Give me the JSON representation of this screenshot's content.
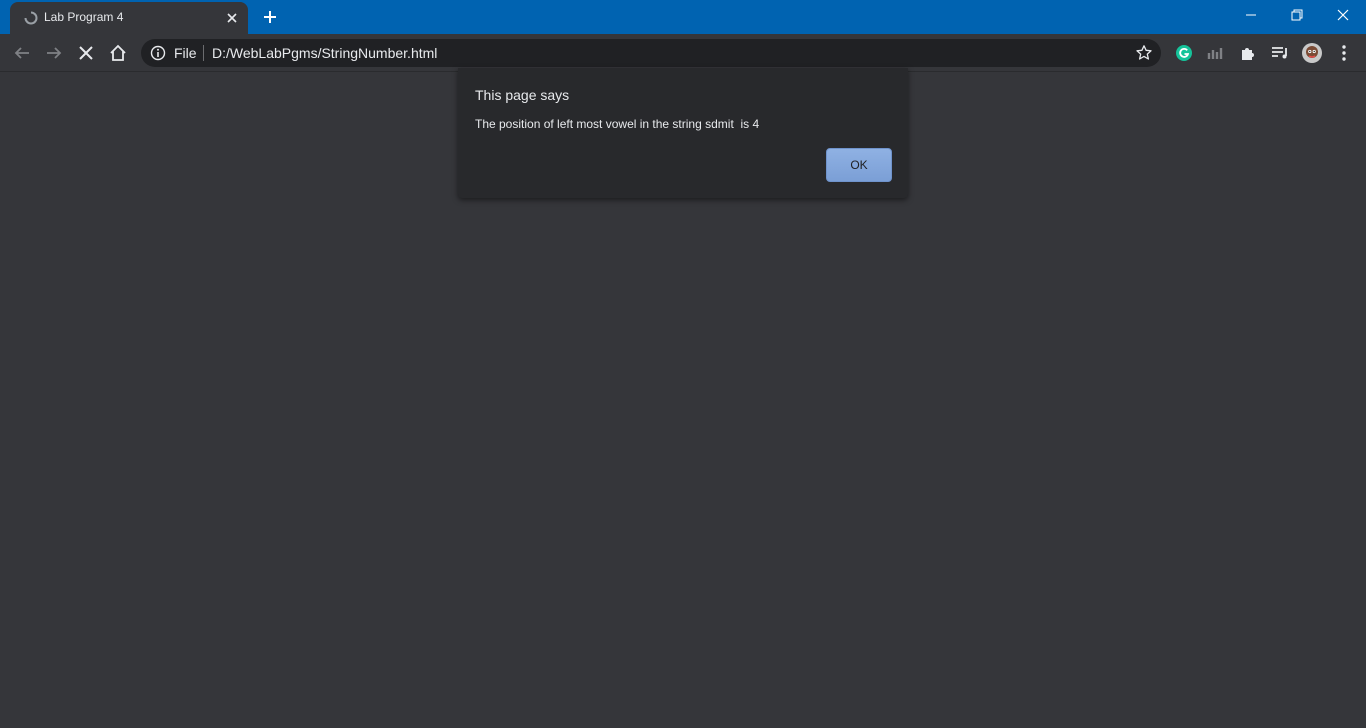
{
  "tab": {
    "title": "Lab Program 4"
  },
  "omnibox": {
    "scheme": "File",
    "url": "D:/WebLabPgms/StringNumber.html"
  },
  "dialog": {
    "heading": "This page says",
    "message": "The position of left most vowel in the string sdmit  is 4",
    "ok_label": "OK"
  },
  "colors": {
    "titlebar": "#0063b1",
    "page_background": "#35363a",
    "dialog_background": "#28292c",
    "ok_button": "#8ab4f8",
    "extension_grammarly": "#15c39a"
  }
}
